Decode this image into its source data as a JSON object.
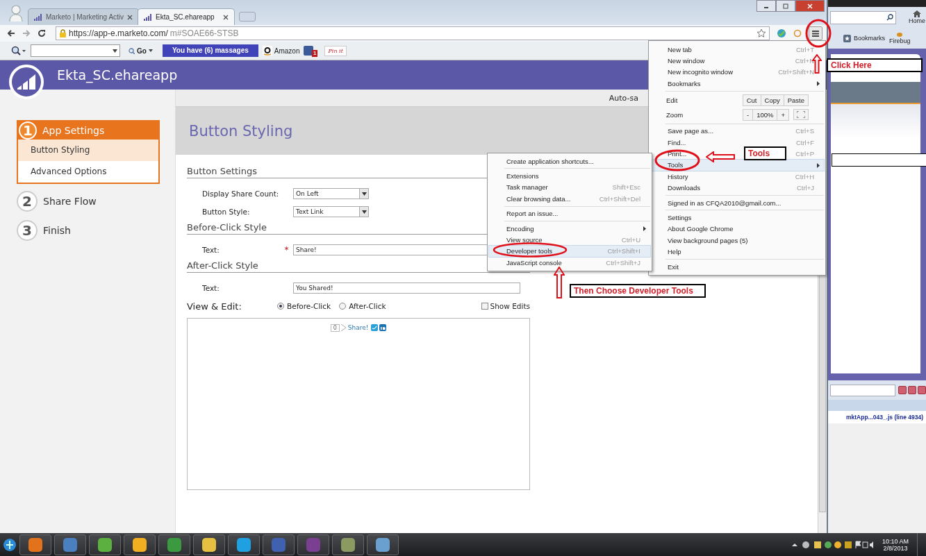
{
  "browser": {
    "tabs": [
      {
        "title": "Marketo | Marketing Activ",
        "selected": false
      },
      {
        "title": "Ekta_SC.ehareapp",
        "selected": true
      }
    ],
    "url": {
      "host": "https://app-e.marketo.com/",
      "path": "m#SOAE66-STSB"
    },
    "toolbar": {
      "go_label": "Go",
      "messages_button": "You have (6) massages",
      "amazon_label": "Amazon",
      "facebook_count": "1",
      "pinit_label": "Pin it"
    }
  },
  "app": {
    "title": "Ekta_SC.ehareapp",
    "autosave": "Auto-sa",
    "steps": [
      {
        "number": "1",
        "label": "App Settings",
        "selected": true,
        "children": [
          {
            "label": "Button Styling",
            "selected": true
          },
          {
            "label": "Advanced Options",
            "selected": false
          }
        ]
      },
      {
        "number": "2",
        "label": "Share Flow",
        "selected": false
      },
      {
        "number": "3",
        "label": "Finish",
        "selected": false
      }
    ],
    "heading": "Button Styling",
    "sections": [
      {
        "title": "Button Settings",
        "fields": [
          {
            "kind": "select",
            "label": "Display Share Count:",
            "value": "On Left",
            "required": false
          },
          {
            "kind": "select",
            "label": "Button Style:",
            "value": "Text Link",
            "required": false
          }
        ]
      },
      {
        "title": "Before-Click Style",
        "fields": [
          {
            "kind": "text",
            "label": "Text:",
            "value": "Share!",
            "required": true
          }
        ]
      },
      {
        "title": "After-Click Style",
        "fields": [
          {
            "kind": "text",
            "label": "Text:",
            "value": "You Shared!",
            "required": false
          }
        ]
      }
    ],
    "view_edit": {
      "label": "View & Edit:",
      "required_mark": "*",
      "radios": [
        {
          "label": "Before-Click",
          "selected": true
        },
        {
          "label": "After-Click",
          "selected": false
        }
      ],
      "show_edits": {
        "label": "Show Edits",
        "checked": false
      },
      "preview": {
        "count": "0",
        "link": "Share!"
      }
    }
  },
  "chrome_menu": {
    "items": [
      {
        "kind": "item",
        "label": "New tab",
        "shortcut": "Ctrl+T",
        "selected": false
      },
      {
        "kind": "item",
        "label": "New window",
        "shortcut": "Ctrl+N",
        "selected": false
      },
      {
        "kind": "item",
        "label": "New incognito window",
        "shortcut": "Ctrl+Shift+N",
        "selected": false
      },
      {
        "kind": "submenu",
        "label": "Bookmarks",
        "selected": false
      },
      {
        "kind": "separator"
      },
      {
        "kind": "edit",
        "label": "Edit",
        "buttons": [
          "Cut",
          "Copy",
          "Paste"
        ]
      },
      {
        "kind": "zoom",
        "label": "Zoom",
        "minus": "-",
        "value": "100%",
        "plus": "+"
      },
      {
        "kind": "separator"
      },
      {
        "kind": "item",
        "label": "Save page as...",
        "shortcut": "Ctrl+S",
        "selected": false
      },
      {
        "kind": "item",
        "label": "Find...",
        "shortcut": "Ctrl+F",
        "selected": false
      },
      {
        "kind": "item",
        "label": "Print...",
        "shortcut": "Ctrl+P",
        "selected": false
      },
      {
        "kind": "submenu",
        "label": "Tools",
        "selected": true
      },
      {
        "kind": "item",
        "label": "History",
        "shortcut": "Ctrl+H",
        "selected": false
      },
      {
        "kind": "item",
        "label": "Downloads",
        "shortcut": "Ctrl+J",
        "selected": false
      },
      {
        "kind": "separator"
      },
      {
        "kind": "item",
        "label": "Signed in as CFQA2010@gmail.com...",
        "selected": false
      },
      {
        "kind": "separator"
      },
      {
        "kind": "item",
        "label": "Settings",
        "selected": false
      },
      {
        "kind": "item",
        "label": "About Google Chrome",
        "selected": false
      },
      {
        "kind": "item",
        "label": "View background pages (5)",
        "selected": false
      },
      {
        "kind": "item",
        "label": "Help",
        "selected": false
      },
      {
        "kind": "separator"
      },
      {
        "kind": "item",
        "label": "Exit",
        "selected": false
      }
    ]
  },
  "tools_menu": {
    "items": [
      {
        "kind": "item",
        "label": "Create application shortcuts...",
        "selected": false
      },
      {
        "kind": "separator"
      },
      {
        "kind": "item",
        "label": "Extensions",
        "selected": false
      },
      {
        "kind": "item",
        "label": "Task manager",
        "shortcut": "Shift+Esc",
        "selected": false
      },
      {
        "kind": "item",
        "label": "Clear browsing data...",
        "shortcut": "Ctrl+Shift+Del",
        "selected": false
      },
      {
        "kind": "separator"
      },
      {
        "kind": "item",
        "label": "Report an issue...",
        "selected": false
      },
      {
        "kind": "separator"
      },
      {
        "kind": "submenu",
        "label": "Encoding",
        "selected": false
      },
      {
        "kind": "item",
        "label": "View source",
        "shortcut": "Ctrl+U",
        "selected": false
      },
      {
        "kind": "item",
        "label": "Developer tools",
        "shortcut": "Ctrl+Shift+I",
        "selected": true
      },
      {
        "kind": "item",
        "label": "JavaScript console",
        "shortcut": "Ctrl+Shift+J",
        "selected": false
      }
    ]
  },
  "annotations": [
    {
      "text": "Click Here"
    },
    {
      "text": "Tools"
    },
    {
      "text": "Then Choose Developer Tools"
    }
  ],
  "side_app": {
    "home_label": "Home",
    "bookmarks_label": "Bookmarks",
    "firebug_label": "Firebug",
    "status": "mktApp...043_.js (line 4934)"
  },
  "taskbar": {
    "time": "10:10 AM",
    "date": "2/8/2013"
  }
}
